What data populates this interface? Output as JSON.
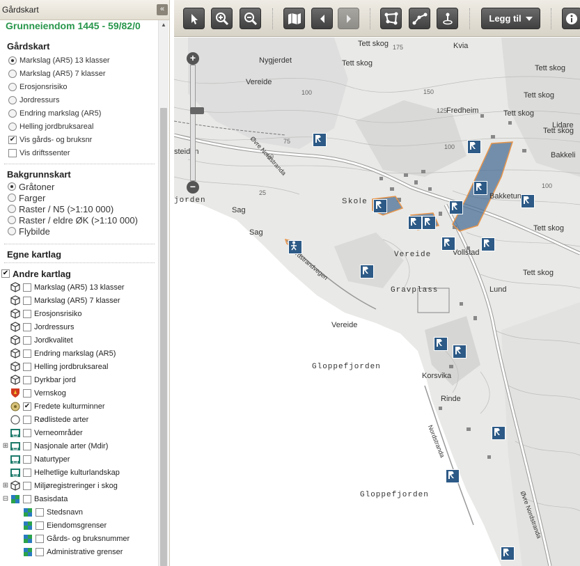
{
  "panel": {
    "header_title": "Gårdskart",
    "collapse_icon": "«",
    "property_title": "Grunneiendom 1445 - 59/82/0",
    "gardskart": {
      "title": "Gårdskart",
      "options": [
        {
          "label": "Markslag (AR5) 13 klasser",
          "type": "radio",
          "checked": true
        },
        {
          "label": "Markslag (AR5) 7 klasser",
          "type": "radio",
          "checked": false
        },
        {
          "label": "Erosjonsrisiko",
          "type": "radio",
          "checked": false
        },
        {
          "label": "Jordressurs",
          "type": "radio",
          "checked": false
        },
        {
          "label": "Endring markslag (AR5)",
          "type": "radio",
          "checked": false
        },
        {
          "label": "Helling jordbruksareal",
          "type": "radio",
          "checked": false
        },
        {
          "label": "Vis gårds- og bruksnr",
          "type": "checkbox",
          "checked": true
        },
        {
          "label": "Vis driftssenter",
          "type": "checkbox",
          "checked": false
        }
      ]
    },
    "bakgrunnskart": {
      "title": "Bakgrunnskart",
      "options": [
        {
          "label": "Gråtoner",
          "checked": true
        },
        {
          "label": "Farger",
          "checked": false
        },
        {
          "label": "Raster / N5 (>1:10 000)",
          "checked": false
        },
        {
          "label": "Raster / eldre ØK (>1:10 000)",
          "checked": false
        },
        {
          "label": "Flybilde",
          "checked": false
        }
      ]
    },
    "egne_kartlag": {
      "title": "Egne kartlag"
    },
    "andre_kartlag": {
      "title": "Andre kartlag",
      "checked": true,
      "layers": [
        {
          "label": "Markslag (AR5) 13 klasser",
          "icon": "cube-icon",
          "checked": false,
          "expander": ""
        },
        {
          "label": "Markslag (AR5) 7 klasser",
          "icon": "cube-icon",
          "checked": false,
          "expander": ""
        },
        {
          "label": "Erosjonsrisiko",
          "icon": "cube-icon",
          "checked": false,
          "expander": ""
        },
        {
          "label": "Jordressurs",
          "icon": "cube-icon",
          "checked": false,
          "expander": ""
        },
        {
          "label": "Jordkvalitet",
          "icon": "cube-icon",
          "checked": false,
          "expander": ""
        },
        {
          "label": "Endring markslag (AR5)",
          "icon": "cube-icon",
          "checked": false,
          "expander": ""
        },
        {
          "label": "Helling jordbruksareal",
          "icon": "cube-icon",
          "checked": false,
          "expander": ""
        },
        {
          "label": "Dyrkbar jord",
          "icon": "cube-icon",
          "checked": false,
          "expander": ""
        },
        {
          "label": "Vernskog",
          "icon": "shield-icon",
          "checked": false,
          "expander": ""
        },
        {
          "label": "Fredete kulturminner",
          "icon": "monument-icon",
          "checked": true,
          "expander": ""
        },
        {
          "label": "Rødlistede arter",
          "icon": "circle-icon",
          "checked": false,
          "expander": ""
        },
        {
          "label": "Verneområder",
          "icon": "book-icon",
          "checked": false,
          "expander": ""
        },
        {
          "label": "Nasjonale arter (Mdir)",
          "icon": "book-icon",
          "checked": false,
          "expander": "⊞"
        },
        {
          "label": "Naturtyper",
          "icon": "book-icon",
          "checked": false,
          "expander": ""
        },
        {
          "label": "Helhetlige kulturlandskap",
          "icon": "book-icon",
          "checked": false,
          "expander": ""
        },
        {
          "label": "Miljøregistreringer i skog",
          "icon": "cube-icon",
          "checked": false,
          "expander": "⊞"
        },
        {
          "label": "Basisdata",
          "icon": "flag-icon",
          "checked": false,
          "expander": "⊟"
        }
      ],
      "basisdata": [
        {
          "label": "Stedsnavn",
          "checked": false
        },
        {
          "label": "Eiendomsgrenser",
          "checked": false
        },
        {
          "label": "Gårds- og bruksnummer",
          "checked": false
        },
        {
          "label": "Administrative grenser",
          "checked": false
        }
      ]
    }
  },
  "toolbar": {
    "legg_til_label": "Legg til",
    "buttons": [
      "pointer-icon",
      "zoom-in-icon",
      "zoom-out-icon",
      "map-icon",
      "back-arrow-icon",
      "forward-arrow-icon",
      "measure-area-icon",
      "measure-line-icon",
      "identify-point-icon",
      "info-icon"
    ]
  },
  "map": {
    "zoom_in_label": "+",
    "zoom_out_label": "−",
    "place_names": [
      {
        "text": "Tett skog",
        "style": "normal"
      },
      {
        "text": "Kvia",
        "style": "normal"
      },
      {
        "text": "Nygjerdet",
        "style": "normal"
      },
      {
        "text": "Tett skog",
        "style": "normal"
      },
      {
        "text": "Tett skog",
        "style": "normal"
      },
      {
        "text": "Vereide",
        "style": "normal"
      },
      {
        "text": "Tett skog",
        "style": "normal"
      },
      {
        "text": "Fredheim",
        "style": "normal"
      },
      {
        "text": "Tett skog",
        "style": "normal"
      },
      {
        "text": "Lidare",
        "style": "normal"
      },
      {
        "text": "Tett skog",
        "style": "normal"
      },
      {
        "text": "steiden",
        "style": "normal"
      },
      {
        "text": "Bakkeli",
        "style": "normal"
      },
      {
        "text": "jorden",
        "style": "wide"
      },
      {
        "text": "Skole",
        "style": "wide"
      },
      {
        "text": "Bakketun",
        "style": "normal"
      },
      {
        "text": "Sag",
        "style": "normal"
      },
      {
        "text": "Sag",
        "style": "normal"
      },
      {
        "text": "Tett skog",
        "style": "normal"
      },
      {
        "text": "Vereide",
        "style": "wide"
      },
      {
        "text": "Vollstad",
        "style": "normal"
      },
      {
        "text": "Tett skog",
        "style": "normal"
      },
      {
        "text": "Gravplass",
        "style": "wide"
      },
      {
        "text": "Lund",
        "style": "normal"
      },
      {
        "text": "Vereide",
        "style": "normal"
      },
      {
        "text": "Gloppefjorden",
        "style": "wide"
      },
      {
        "text": "Korsvika",
        "style": "normal"
      },
      {
        "text": "Rinde",
        "style": "normal"
      },
      {
        "text": "Gloppefjorden",
        "style": "wide"
      }
    ],
    "contours": [
      "175",
      "125",
      "150",
      "100",
      "75",
      "50",
      "25",
      "100",
      "100"
    ],
    "road_labels": [
      "Øvre Nordstranda",
      "Nordstranda",
      "Nordstrandvegen",
      "Øvre Nordstranda"
    ]
  }
}
